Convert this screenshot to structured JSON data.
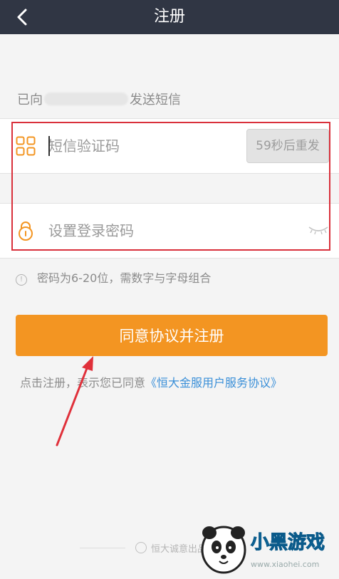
{
  "header": {
    "title": "注册"
  },
  "sms_notice": {
    "prefix": "已向",
    "suffix": "发送短信"
  },
  "sms_code": {
    "placeholder": "短信验证码",
    "resend_label": "59秒后重发"
  },
  "password": {
    "placeholder": "设置登录密码"
  },
  "password_hint": {
    "icon_glyph": "!",
    "text": "密码为6-20位，需数字与字母组合"
  },
  "submit": {
    "label": "同意协议并注册"
  },
  "terms": {
    "prefix": "点击注册，表示您已同意",
    "link": "《恒大金服用户服务协议》"
  },
  "footer": {
    "text": "恒大诚意出品"
  },
  "watermark": {
    "brand": "小黑游戏",
    "url": "www.xiaohei.com"
  },
  "colors": {
    "header_bg": "#303644",
    "accent_orange": "#f39522",
    "link_blue": "#3a8fd8",
    "highlight_red": "#d9303b"
  }
}
